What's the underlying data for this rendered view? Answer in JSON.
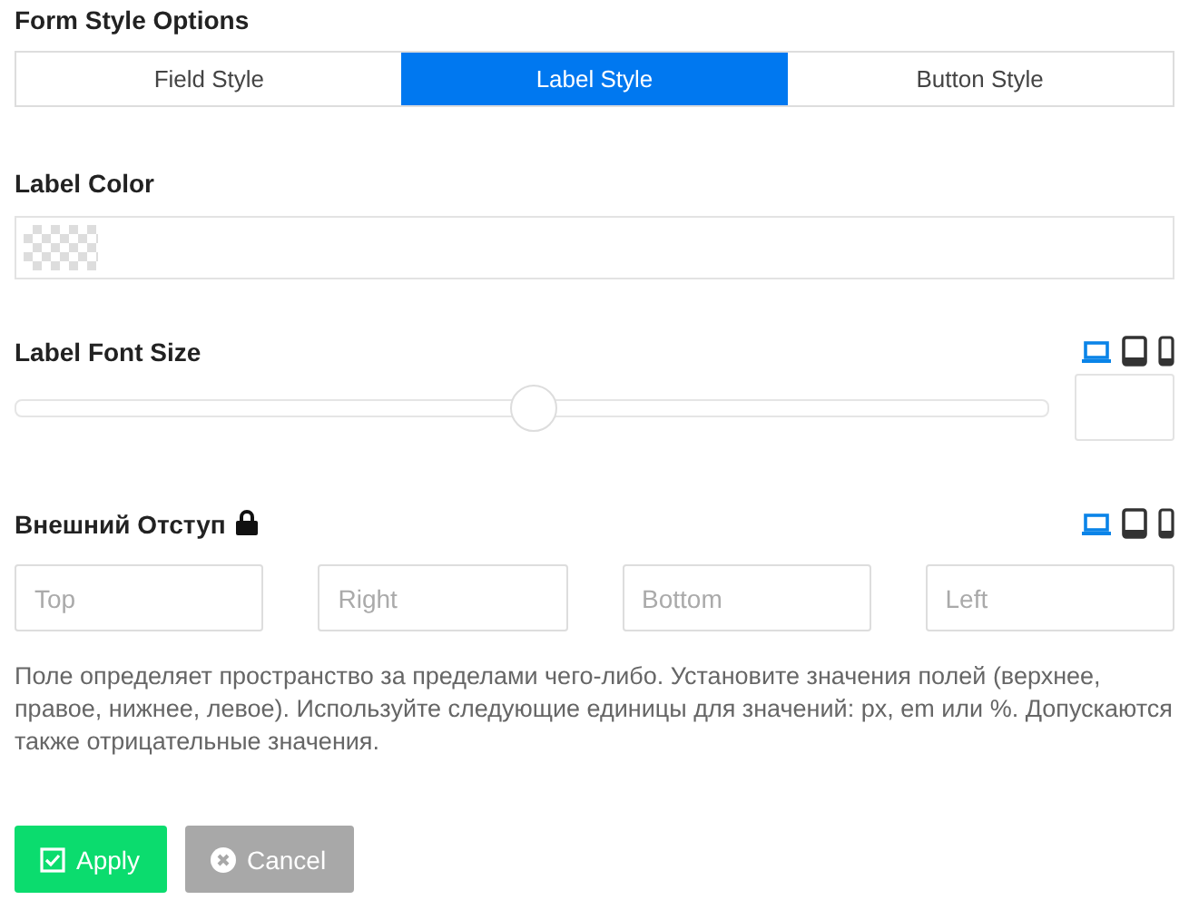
{
  "title": "Form Style Options",
  "tabs": [
    {
      "label": "Field Style",
      "selected": false
    },
    {
      "label": "Label Style",
      "selected": true
    },
    {
      "label": "Button Style",
      "selected": false
    }
  ],
  "label_color": {
    "label": "Label Color"
  },
  "font_size": {
    "label": "Label Font Size",
    "devices": [
      {
        "kind": "desktop",
        "selected": true
      },
      {
        "kind": "tablet",
        "selected": false
      },
      {
        "kind": "mobile",
        "selected": false
      }
    ],
    "level": 0.5
  },
  "margin": {
    "label": "Внешний Отступ",
    "locked": true,
    "devices": [
      {
        "kind": "desktop",
        "selected": true
      },
      {
        "kind": "tablet",
        "selected": false
      },
      {
        "kind": "mobile",
        "selected": false
      }
    ],
    "fields": [
      {
        "placeholder": "Top"
      },
      {
        "placeholder": "Right"
      },
      {
        "placeholder": "Bottom"
      },
      {
        "placeholder": "Left"
      }
    ],
    "help": "Поле определяет пространство за пределами чего-либо. Установите значения полей (верхнее, правое, нижнее, левое). Используйте следующие единицы для значений: px, em или %. Допускаются также отрицательные значения."
  },
  "buttons": [
    {
      "label": "Apply",
      "kind": "apply"
    },
    {
      "label": "Cancel",
      "kind": "cancel"
    }
  ]
}
